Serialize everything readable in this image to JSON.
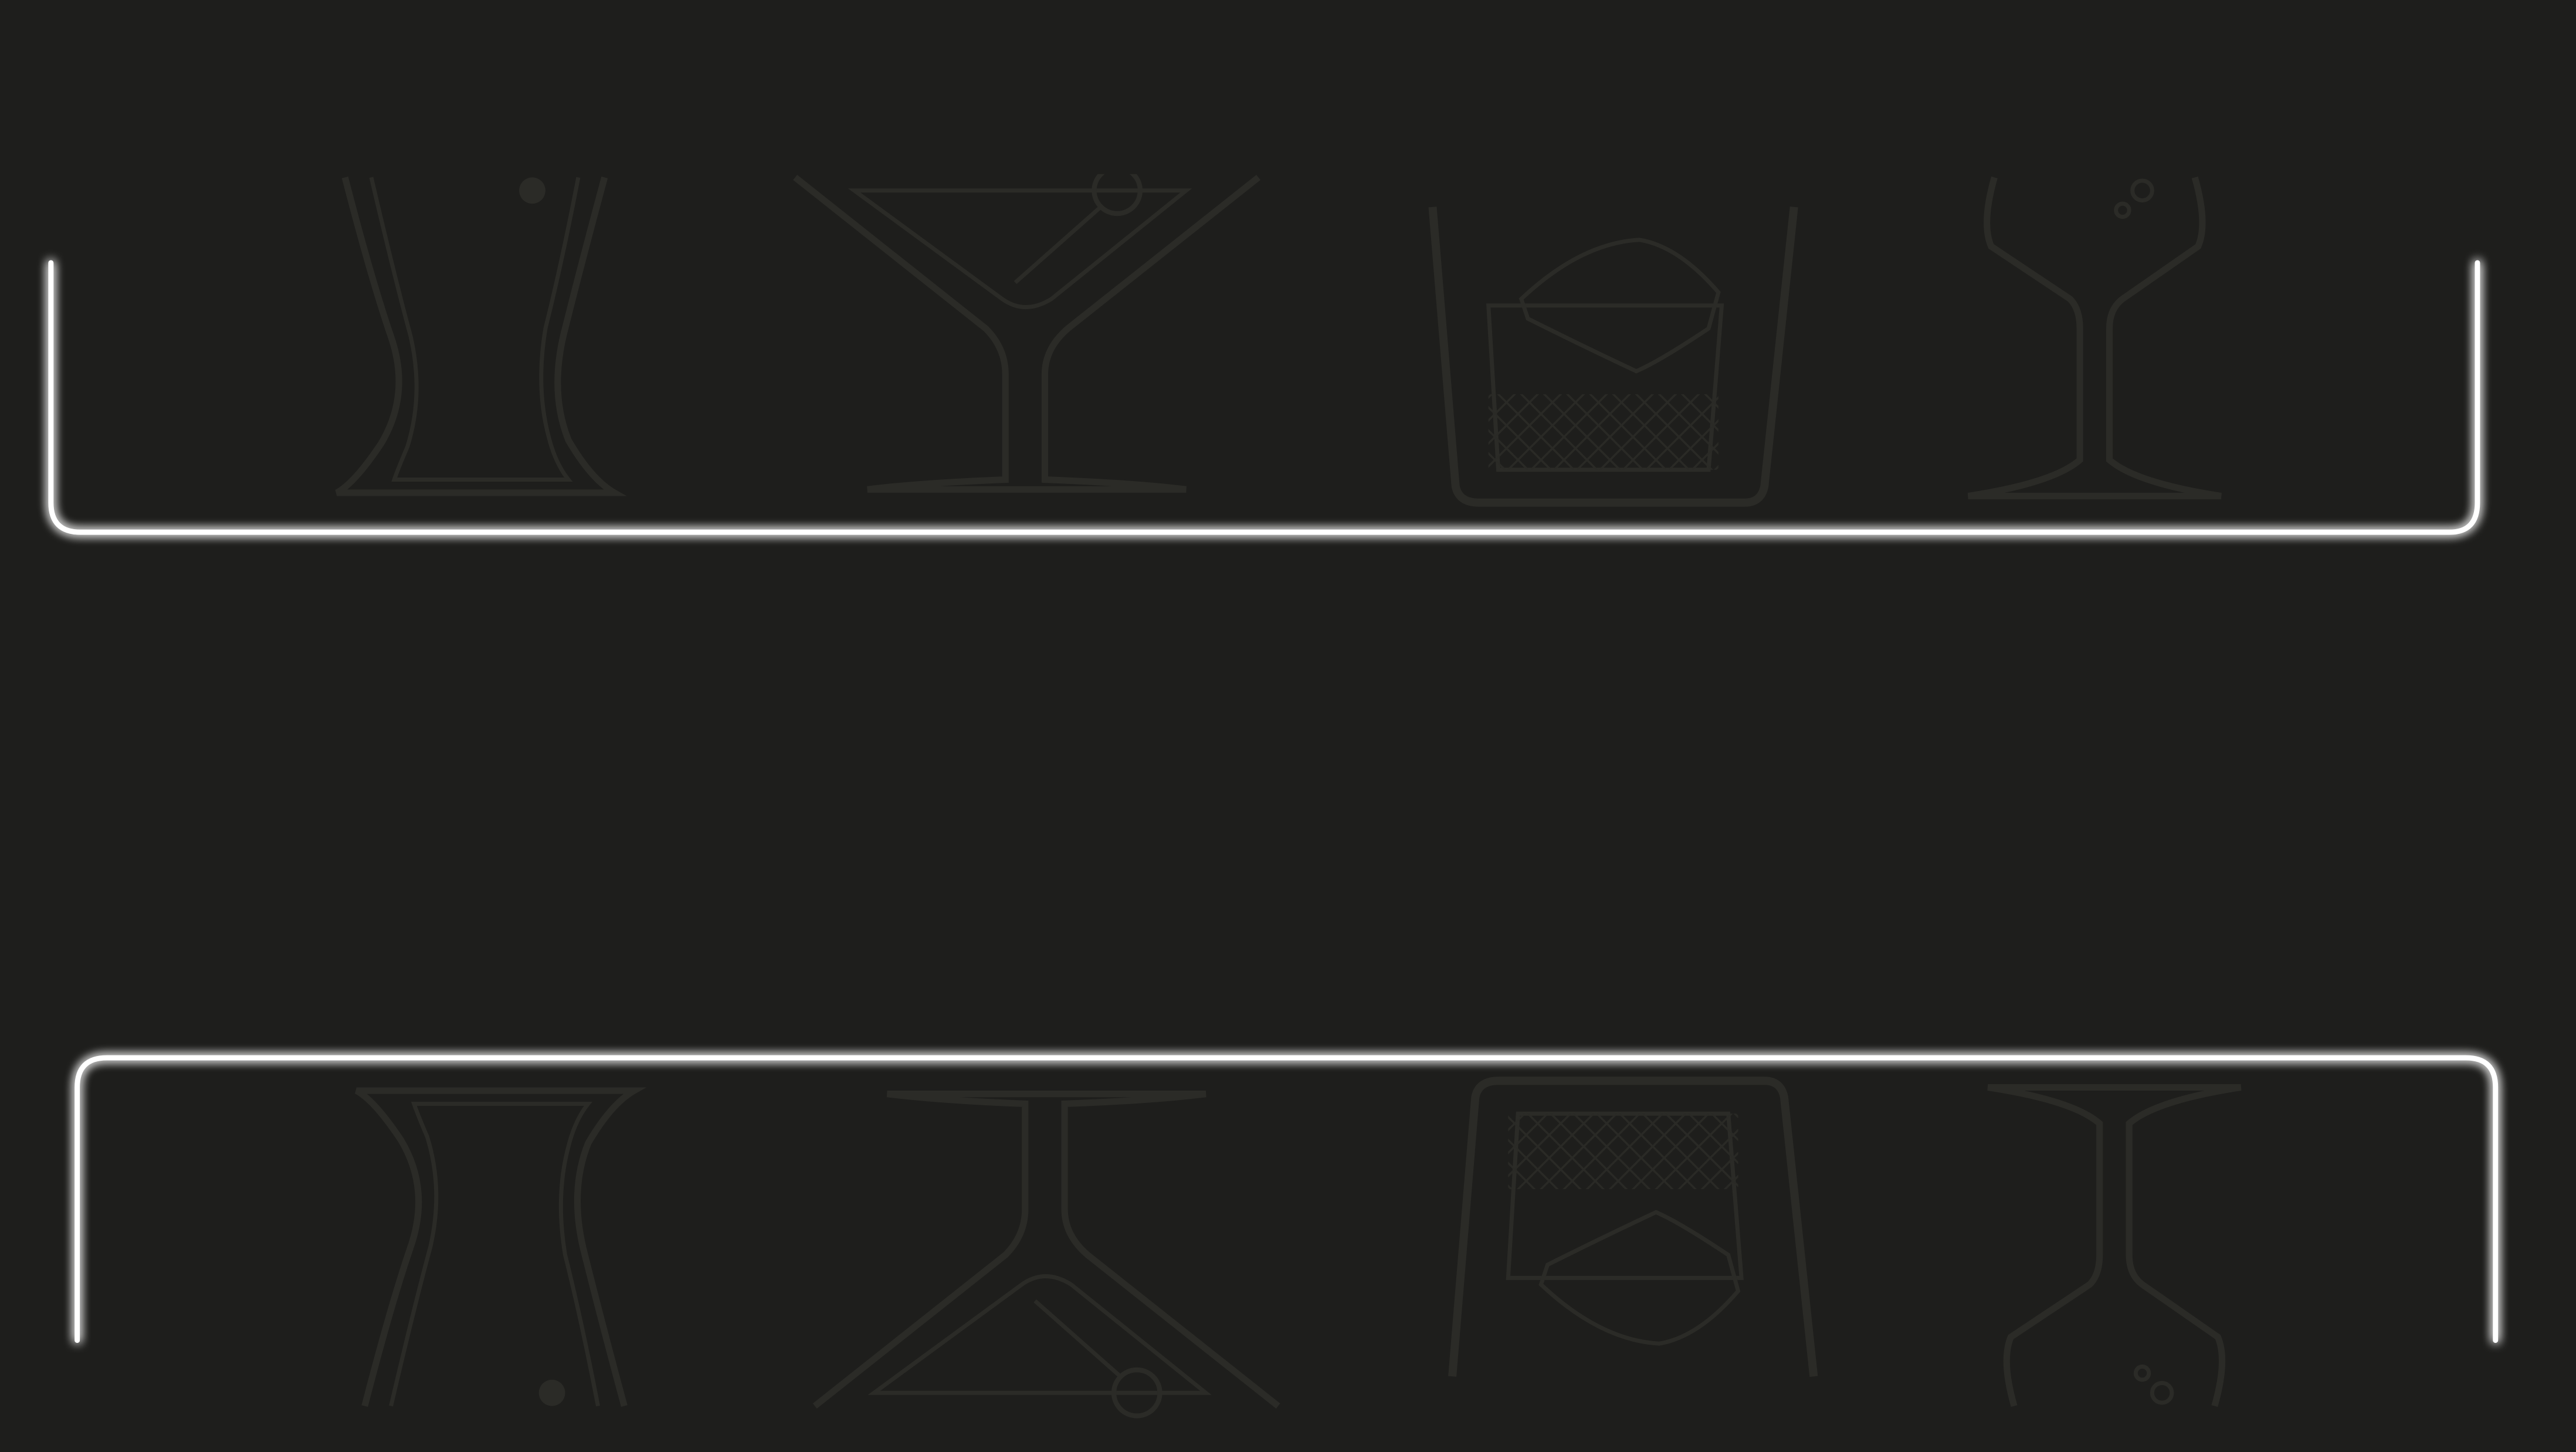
{
  "colors": {
    "background": "#1e1e1c",
    "glass_outline": "#2b2b27",
    "neon_white": "#ffffff",
    "neon_glow": "#9a9a9a"
  },
  "shelves": [
    {
      "name": "top-shelf",
      "orientation": "upright",
      "glasses": [
        "highball-glass-icon",
        "martini-glass-icon",
        "rocks-glass-icon",
        "coupe-glass-icon"
      ]
    },
    {
      "name": "bottom-shelf",
      "orientation": "inverted",
      "glasses": [
        "highball-glass-icon",
        "martini-glass-icon",
        "rocks-glass-icon",
        "coupe-glass-icon"
      ]
    }
  ]
}
